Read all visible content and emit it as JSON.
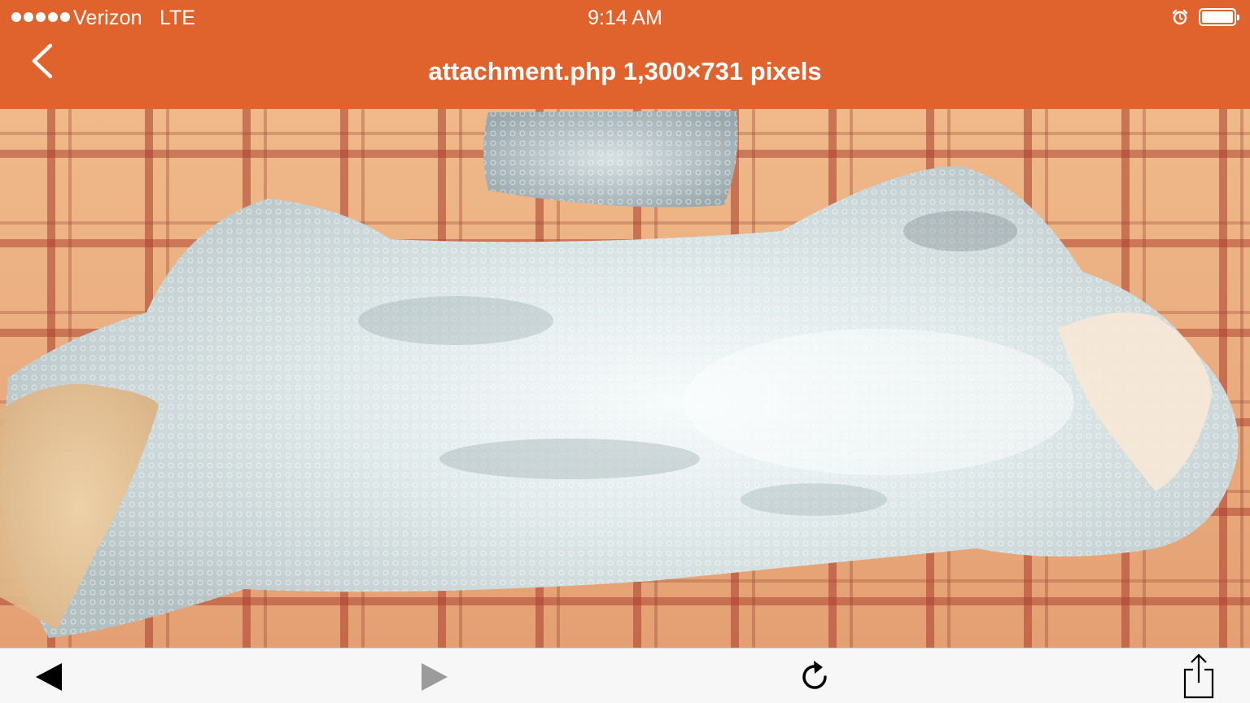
{
  "status_bar": {
    "carrier": "Verizon",
    "network": "LTE",
    "time": "9:14 AM",
    "signal_bars": 5,
    "battery_level": 1.0
  },
  "nav": {
    "back_icon": "chevron-left-icon",
    "title": "attachment.php 1,300×731 pixels"
  },
  "colors": {
    "header": "#e0632e",
    "toolbar": "#f7f7f7"
  },
  "toolbar": {
    "back_icon": "triangle-left-icon",
    "forward_icon": "triangle-right-icon",
    "forward_enabled": false,
    "reload_icon": "reload-icon",
    "share_icon": "share-icon"
  }
}
